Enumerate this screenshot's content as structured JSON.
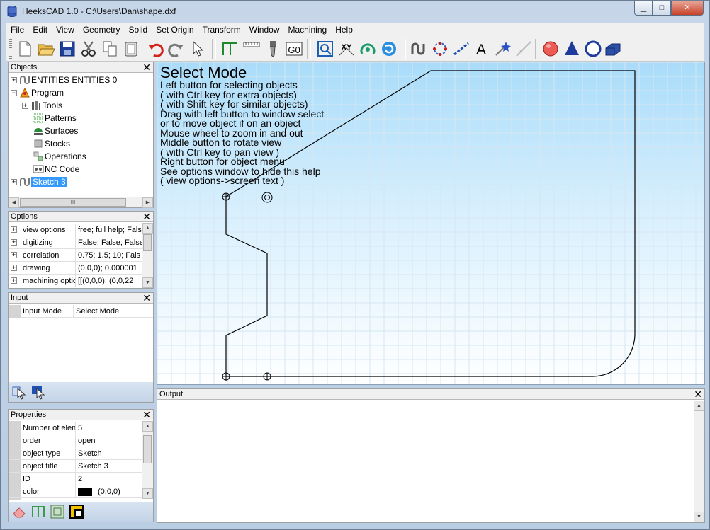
{
  "window": {
    "title": "HeeksCAD 1.0 - C:\\Users\\Dan\\shape.dxf",
    "min_label": "▁",
    "max_label": "□",
    "close_label": "✕"
  },
  "menu": [
    "File",
    "Edit",
    "View",
    "Geometry",
    "Solid",
    "Set Origin",
    "Transform",
    "Window",
    "Machining",
    "Help"
  ],
  "toolbar": {
    "icons": [
      "new-icon",
      "open-icon",
      "save-icon",
      "cut-icon",
      "copy-icon",
      "paste-icon",
      "undo-icon",
      "redo-icon",
      "select-icon",
      "sketch-profile-icon",
      "ruler-icon",
      "drill-icon",
      "g0-icon",
      "view-zoom-icon",
      "view-xy-icon",
      "rotate-view-icon",
      "refresh-icon",
      "spline-icon",
      "point-circle-icon",
      "line-icon",
      "text-icon",
      "magic-icon",
      "cross-icon",
      "sphere-icon",
      "cone-icon",
      "circle-icon",
      "machine-icon"
    ],
    "g0_label": "G0",
    "xy_label": "XY",
    "text_label": "A"
  },
  "objects": {
    "title": "Objects",
    "close": "✕",
    "items": [
      {
        "label": "ENTITIES ENTITIES 0",
        "expander": "+",
        "icon": "sketch-icon"
      },
      {
        "label": "Program",
        "expander": "−",
        "icon": "program-icon"
      },
      {
        "label": "Tools",
        "expander": "+",
        "icon": "tools-icon"
      },
      {
        "label": "Patterns",
        "expander": "",
        "icon": "patterns-icon"
      },
      {
        "label": "Surfaces",
        "expander": "",
        "icon": "surfaces-icon"
      },
      {
        "label": "Stocks",
        "expander": "",
        "icon": "stocks-icon"
      },
      {
        "label": "Operations",
        "expander": "",
        "icon": "operations-icon"
      },
      {
        "label": "NC Code",
        "expander": "",
        "icon": "nc-code-icon"
      },
      {
        "label": "Sketch 3",
        "expander": "+",
        "icon": "sketch-icon"
      }
    ],
    "hscroll_thumb": "III"
  },
  "options": {
    "title": "Options",
    "close": "✕",
    "rows": [
      {
        "name": "view options",
        "value": "free; full help; Fals"
      },
      {
        "name": "digitizing",
        "value": "False; False; False"
      },
      {
        "name": "correlation",
        "value": "0.75; 1.5; 10; Fals"
      },
      {
        "name": "drawing",
        "value": "(0,0,0); 0.000001"
      },
      {
        "name": "machining optio",
        "value": "[[(0,0,0); (0,0,22"
      }
    ]
  },
  "input": {
    "title": "Input",
    "close": "✕",
    "rows": [
      {
        "name": "Input Mode",
        "value": "Select Mode"
      }
    ]
  },
  "properties": {
    "title": "Properties",
    "close": "✕",
    "rows": [
      {
        "name": "Number of elen",
        "value": "5"
      },
      {
        "name": "order",
        "value": "open"
      },
      {
        "name": "object type",
        "value": "Sketch"
      },
      {
        "name": "object title",
        "value": "Sketch 3"
      },
      {
        "name": "ID",
        "value": "2"
      },
      {
        "name": "color",
        "value": "(0,0,0)"
      }
    ]
  },
  "help": {
    "heading": "Select Mode",
    "lines": [
      "Left button for selecting objects",
      "( with Ctrl key for extra objects)",
      "( with Shift key for similar objects)",
      "Drag with left button to window select",
      "or to move object if on an object",
      "Mouse wheel to zoom in and out",
      "Middle button to rotate view",
      "( with Ctrl key to pan view )",
      "Right button for object menu",
      "See options window to hide this help",
      "( view options->screen text )"
    ]
  },
  "output": {
    "title": "Output",
    "close": "✕"
  },
  "colors": {
    "selection": "#3399ff",
    "swatch": "#000000"
  }
}
